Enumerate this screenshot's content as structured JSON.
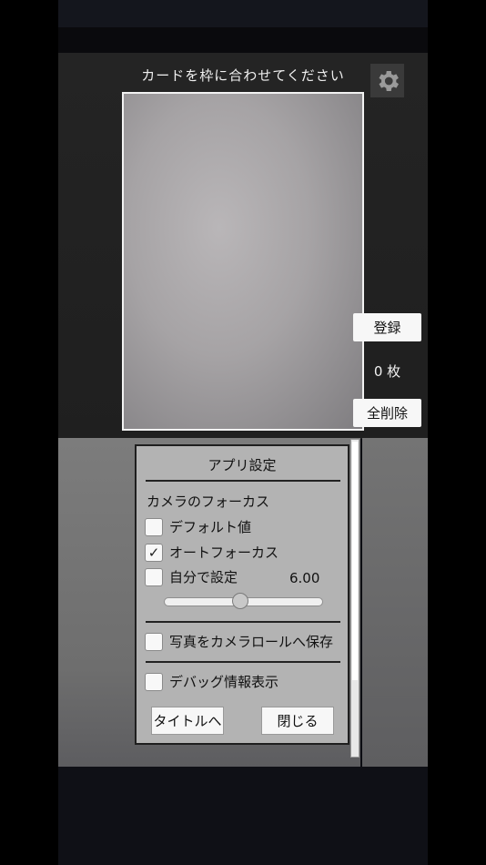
{
  "header": {
    "instruction": "カードを枠に合わせてください",
    "settings_icon": "gear-icon"
  },
  "side": {
    "register_label": "登録",
    "count_text": "0 枚",
    "delete_all_label": "全削除"
  },
  "settings_panel": {
    "title": "アプリ設定",
    "focus_section": "カメラのフォーカス",
    "options": [
      {
        "label": "デフォルト値",
        "checked": false
      },
      {
        "label": "オートフォーカス",
        "checked": true
      },
      {
        "label": "自分で設定",
        "checked": false
      }
    ],
    "focus_value": "6.00",
    "slider_fraction": 0.48,
    "save_to_roll": {
      "label": "写真をカメラロールへ保存",
      "checked": false
    },
    "debug_info": {
      "label": "デバッグ情報表示",
      "checked": false
    },
    "to_title_label": "タイトルへ",
    "close_label": "閉じる"
  }
}
